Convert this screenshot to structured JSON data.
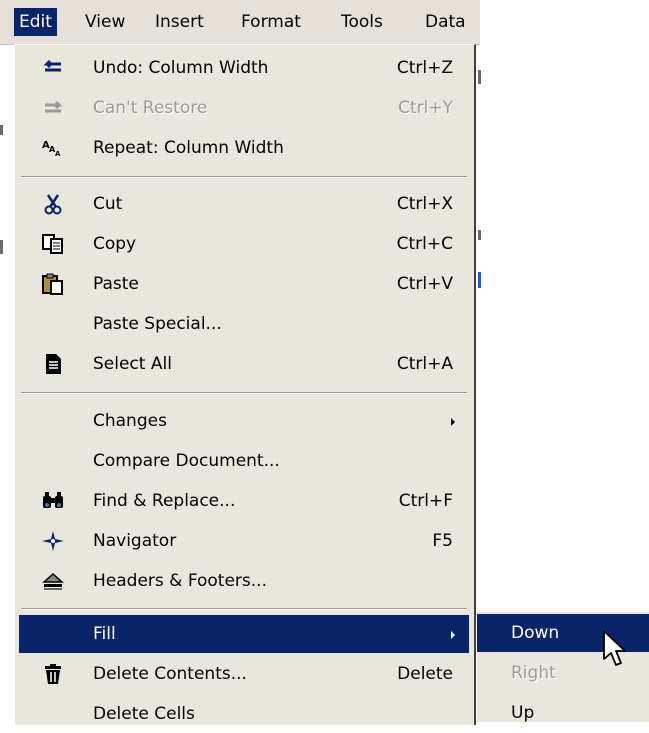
{
  "menubar": {
    "items": [
      {
        "label": "Edit",
        "active": true
      },
      {
        "label": "View"
      },
      {
        "label": "Insert"
      },
      {
        "label": "Format"
      },
      {
        "label": "Tools"
      },
      {
        "label": "Data"
      }
    ]
  },
  "edit_menu": {
    "items": [
      {
        "label": "Undo: Column Width",
        "shortcut": "Ctrl+Z",
        "icon": "undo-icon"
      },
      {
        "label": "Can't Restore",
        "shortcut": "Ctrl+Y",
        "icon": "redo-icon",
        "disabled": true
      },
      {
        "label": "Repeat: Column Width",
        "shortcut": "",
        "icon": "repeat-icon"
      },
      {
        "label": "Cut",
        "shortcut": "Ctrl+X",
        "icon": "scissors-icon"
      },
      {
        "label": "Copy",
        "shortcut": "Ctrl+C",
        "icon": "copy-icon"
      },
      {
        "label": "Paste",
        "shortcut": "Ctrl+V",
        "icon": "paste-icon"
      },
      {
        "label": "Paste Special...",
        "shortcut": ""
      },
      {
        "label": "Select All",
        "shortcut": "Ctrl+A",
        "icon": "select-all-icon"
      },
      {
        "label": "Changes",
        "shortcut": "",
        "submenu": true
      },
      {
        "label": "Compare Document...",
        "shortcut": ""
      },
      {
        "label": "Find & Replace...",
        "shortcut": "Ctrl+F",
        "icon": "binoculars-icon"
      },
      {
        "label": "Navigator",
        "shortcut": "F5",
        "icon": "navigator-icon"
      },
      {
        "label": "Headers & Footers...",
        "shortcut": "",
        "icon": "headers-footers-icon"
      },
      {
        "label": "Fill",
        "shortcut": "",
        "submenu": true,
        "highlighted": true
      },
      {
        "label": "Delete Contents...",
        "shortcut": "Delete",
        "icon": "trash-icon"
      },
      {
        "label": "Delete Cells",
        "shortcut": ""
      }
    ]
  },
  "fill_submenu": {
    "items": [
      {
        "label": "Down",
        "highlighted": true
      },
      {
        "label": "Right",
        "disabled": true
      },
      {
        "label": "Up"
      }
    ]
  },
  "colors": {
    "menu_bg": "#e9e6de",
    "highlight": "#0a246a",
    "disabled_text": "#9c9a94"
  }
}
